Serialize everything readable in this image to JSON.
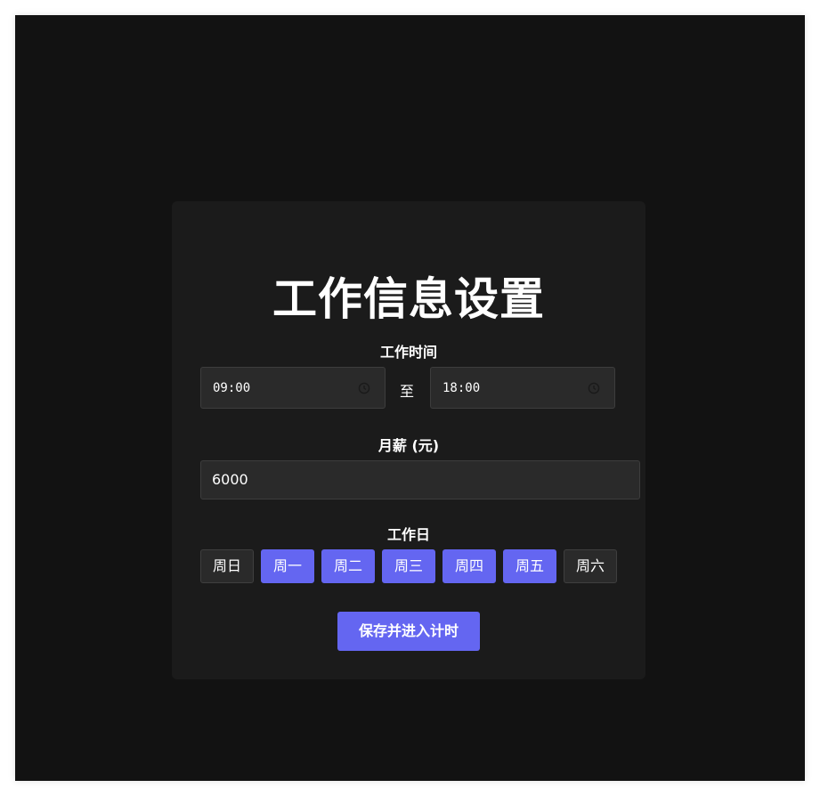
{
  "form": {
    "title": "工作信息设置",
    "work_time_label": "工作时间",
    "start_time": "09:00",
    "to_text": "至",
    "end_time": "18:00",
    "salary_label": "月薪 (元)",
    "salary_value": "6000",
    "workdays_label": "工作日",
    "days": [
      {
        "label": "周日",
        "selected": false
      },
      {
        "label": "周一",
        "selected": true
      },
      {
        "label": "周二",
        "selected": true
      },
      {
        "label": "周三",
        "selected": true
      },
      {
        "label": "周四",
        "selected": true
      },
      {
        "label": "周五",
        "selected": true
      },
      {
        "label": "周六",
        "selected": false
      }
    ],
    "save_label": "保存并进入计时"
  },
  "colors": {
    "accent": "#6466f1",
    "background": "#121212",
    "card": "#1b1b1b",
    "input": "#2a2a2a"
  }
}
